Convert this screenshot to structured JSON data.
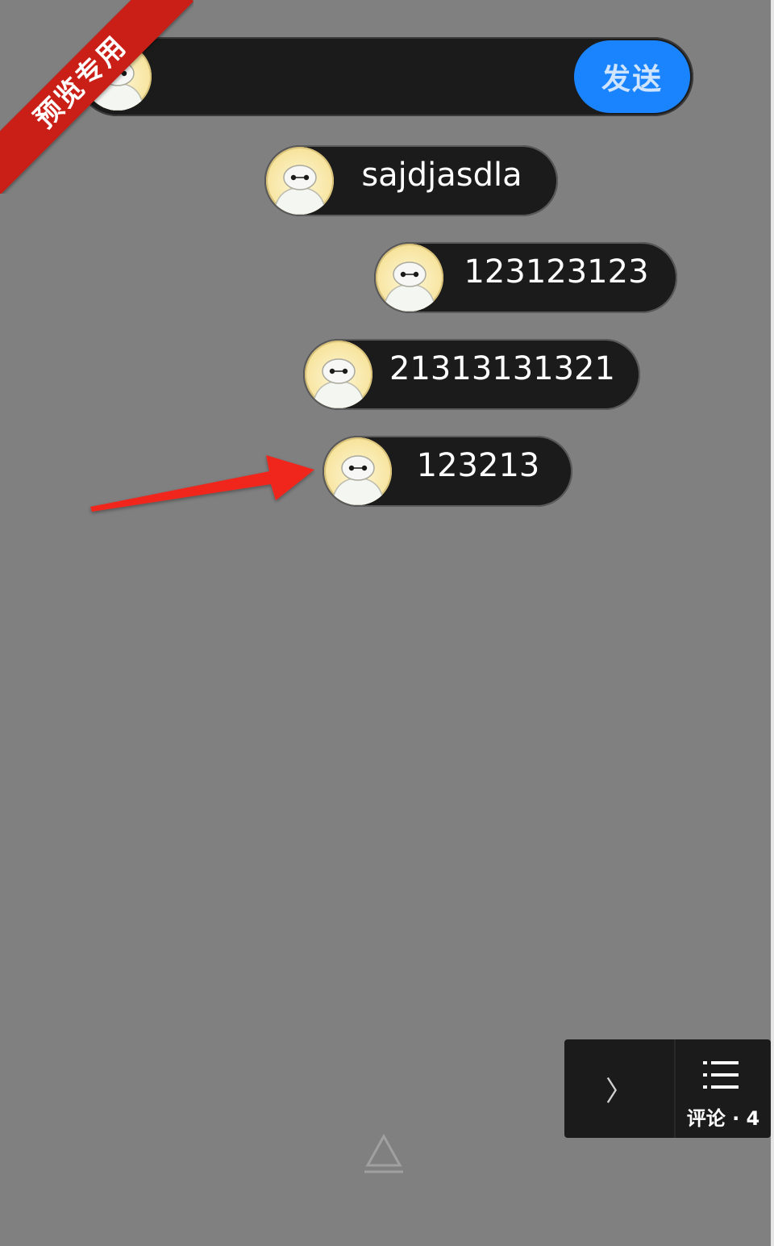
{
  "ribbon": {
    "label": "预览专用"
  },
  "input_bar": {
    "placeholder": "",
    "value": "",
    "send_label": "发送"
  },
  "comments": [
    {
      "text": "sajdjasdla"
    },
    {
      "text": "123123123"
    },
    {
      "text": "21313131321"
    },
    {
      "text": "123213"
    }
  ],
  "side_panel": {
    "expand_glyph": "〉",
    "comments_label": "评论 · 4",
    "icon": "list-icon"
  },
  "colors": {
    "background": "#808080",
    "bubble": "#1b1b1b",
    "send_button": "#1a84ff",
    "ribbon": "#c91f17",
    "arrow": "#f0281e"
  }
}
